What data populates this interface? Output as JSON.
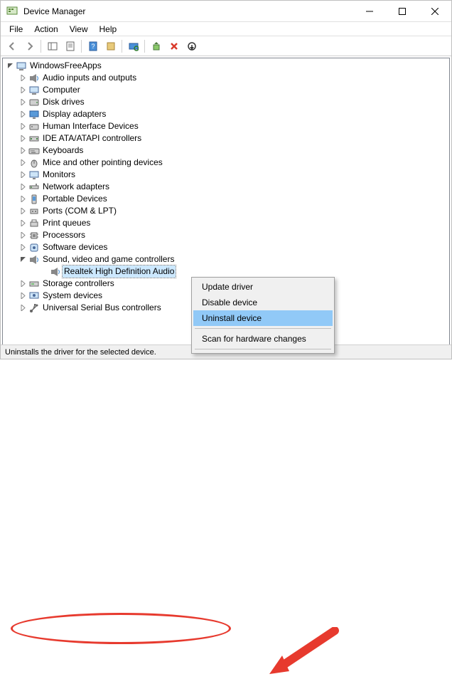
{
  "window": {
    "title": "Device Manager"
  },
  "menubar": {
    "items": [
      "File",
      "Action",
      "View",
      "Help"
    ]
  },
  "tree": {
    "root": {
      "label": "WindowsFreeApps",
      "expanded": true
    },
    "categories": [
      {
        "label": "Audio inputs and outputs",
        "expanded": false,
        "icon": "speaker"
      },
      {
        "label": "Computer",
        "expanded": false,
        "icon": "computer"
      },
      {
        "label": "Disk drives",
        "expanded": false,
        "icon": "disk"
      },
      {
        "label": "Display adapters",
        "expanded": false,
        "icon": "display"
      },
      {
        "label": "Human Interface Devices",
        "expanded": false,
        "icon": "hid"
      },
      {
        "label": "IDE ATA/ATAPI controllers",
        "expanded": false,
        "icon": "ide"
      },
      {
        "label": "Keyboards",
        "expanded": false,
        "icon": "keyboard"
      },
      {
        "label": "Mice and other pointing devices",
        "expanded": false,
        "icon": "mouse"
      },
      {
        "label": "Monitors",
        "expanded": false,
        "icon": "monitor"
      },
      {
        "label": "Network adapters",
        "expanded": false,
        "icon": "network"
      },
      {
        "label": "Portable Devices",
        "expanded": false,
        "icon": "portable"
      },
      {
        "label": "Ports (COM & LPT)",
        "expanded": false,
        "icon": "port"
      },
      {
        "label": "Print queues",
        "expanded": false,
        "icon": "printer"
      },
      {
        "label": "Processors",
        "expanded": false,
        "icon": "cpu"
      },
      {
        "label": "Software devices",
        "expanded": false,
        "icon": "software"
      },
      {
        "label": "Sound, video and game controllers",
        "expanded": true,
        "icon": "sound",
        "children": [
          {
            "label": "Realtek High Definition Audio",
            "icon": "speaker",
            "selected": true
          }
        ]
      },
      {
        "label": "Storage controllers",
        "expanded": false,
        "icon": "storage"
      },
      {
        "label": "System devices",
        "expanded": false,
        "icon": "system"
      },
      {
        "label": "Universal Serial Bus controllers",
        "expanded": false,
        "icon": "usb"
      }
    ]
  },
  "context_menu": {
    "items": [
      {
        "label": "Update driver"
      },
      {
        "label": "Disable device"
      },
      {
        "label": "Uninstall device",
        "highlight": true
      },
      {
        "sep": true
      },
      {
        "label": "Scan for hardware changes"
      },
      {
        "sep": true
      }
    ]
  },
  "statusbar": {
    "text": "Uninstalls the driver for the selected device."
  }
}
